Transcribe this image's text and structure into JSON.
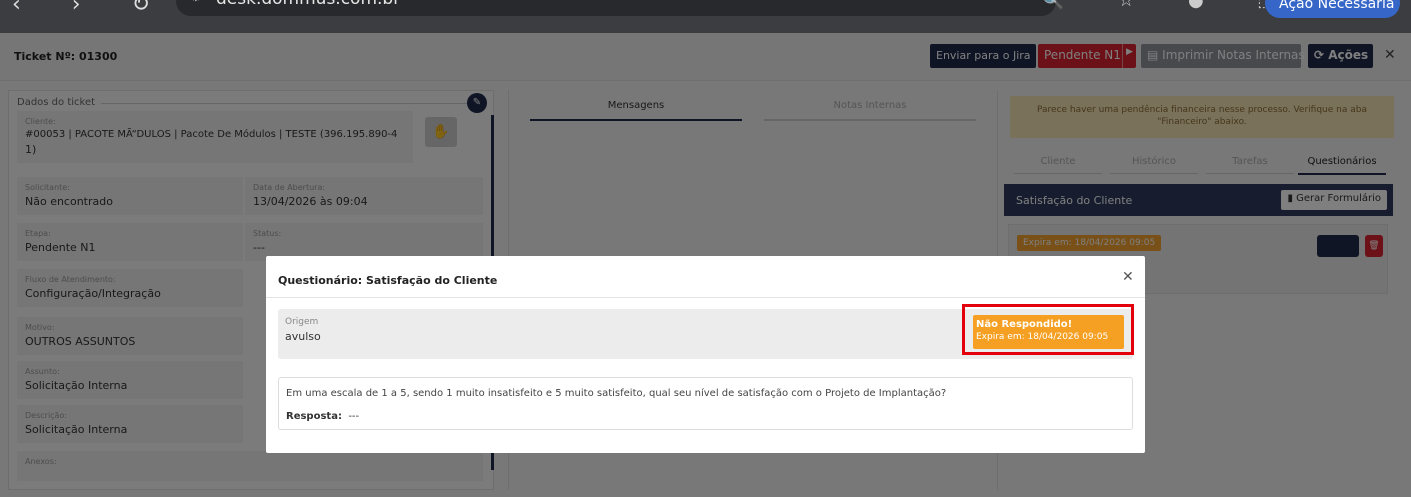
{
  "browser": {
    "url": "desk.dommus.com.br",
    "action_label": "Ação Necessária"
  },
  "header": {
    "ticket_label": "Ticket Nº: 01300",
    "btn_jira": "Enviar para o Jira",
    "btn_pendente": "Pendente N1",
    "btn_notas": "Imprimir Notas Internas",
    "btn_acoes": "Ações"
  },
  "left": {
    "section_title": "Dados do ticket",
    "fields": [
      {
        "label": "Cliente:",
        "value": "#00053 | PACOTE MÃ“DULOS | Pacote De Módulos | TESTE (396.195.890-4"
      },
      {
        "label": "Solicitante:",
        "value": "Não encontrado"
      },
      {
        "label": "Data de Abertura:",
        "value": "13/04/2026 às 09:04"
      },
      {
        "label": "Etapa:",
        "value": "Pendente N1"
      },
      {
        "label": "Status:",
        "value": "---"
      },
      {
        "label": "Fluxo de Atendimento:",
        "value": "Configuração/Integração"
      },
      {
        "label": "Motivo:",
        "value": "OUTROS ASSUNTOS"
      },
      {
        "label": "Assunto:",
        "value": "Solicitação Interna"
      },
      {
        "label": "Descrição:",
        "value": "Solicitação Interna"
      },
      {
        "label": "Anexos:",
        "value": ""
      }
    ],
    "cliente_value_line2": "1)"
  },
  "middle": {
    "tab_mensagens": "Mensagens",
    "tab_notas": "Notas Internas"
  },
  "right": {
    "warning": "Parece haver uma pendência financeira nesse processo. Verifique na aba \"Financeiro\" abaixo.",
    "tabs": [
      "Cliente",
      "Histórico",
      "Tarefas",
      "Questionários"
    ],
    "panel_title": "Satisfação do Cliente",
    "gerar_label": "Gerar Formulário",
    "expira_label": "Expira em: 18/04/2026 09:05"
  },
  "modal": {
    "title": "Questionário: Satisfação do Cliente",
    "origem_label": "Origem",
    "origem_value": "avulso",
    "status_title": "Não Respondido!",
    "status_expira": "Expira em: 18/04/2026 09:05",
    "question": "Em uma escala de 1 a 5, sendo 1 muito insatisfeito e 5 muito satisfeito, qual seu nível de satisfação com o Projeto de Implantação?",
    "answer_label": "Resposta:",
    "answer_value": "---"
  },
  "colors": {
    "navy": "#1e2a4a",
    "red": "#d9232e",
    "orange": "#f5a022",
    "highlight": "#e3000b"
  }
}
